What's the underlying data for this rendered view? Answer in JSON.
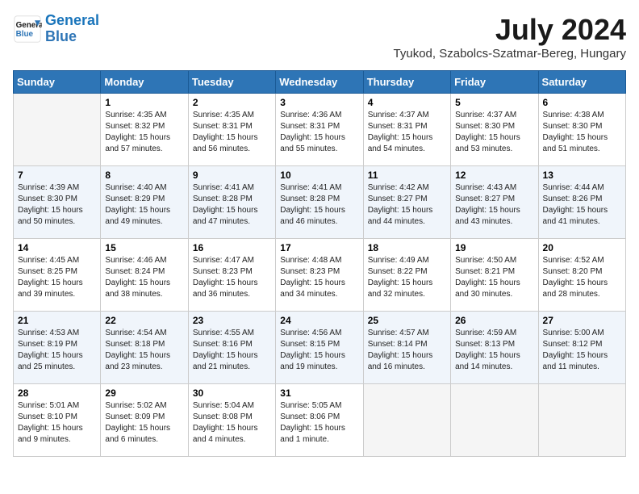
{
  "header": {
    "logo_line1": "General",
    "logo_line2": "Blue",
    "main_title": "July 2024",
    "subtitle": "Tyukod, Szabolcs-Szatmar-Bereg, Hungary"
  },
  "columns": [
    "Sunday",
    "Monday",
    "Tuesday",
    "Wednesday",
    "Thursday",
    "Friday",
    "Saturday"
  ],
  "weeks": [
    [
      {
        "day": "",
        "info": ""
      },
      {
        "day": "1",
        "info": "Sunrise: 4:35 AM\nSunset: 8:32 PM\nDaylight: 15 hours\nand 57 minutes."
      },
      {
        "day": "2",
        "info": "Sunrise: 4:35 AM\nSunset: 8:31 PM\nDaylight: 15 hours\nand 56 minutes."
      },
      {
        "day": "3",
        "info": "Sunrise: 4:36 AM\nSunset: 8:31 PM\nDaylight: 15 hours\nand 55 minutes."
      },
      {
        "day": "4",
        "info": "Sunrise: 4:37 AM\nSunset: 8:31 PM\nDaylight: 15 hours\nand 54 minutes."
      },
      {
        "day": "5",
        "info": "Sunrise: 4:37 AM\nSunset: 8:30 PM\nDaylight: 15 hours\nand 53 minutes."
      },
      {
        "day": "6",
        "info": "Sunrise: 4:38 AM\nSunset: 8:30 PM\nDaylight: 15 hours\nand 51 minutes."
      }
    ],
    [
      {
        "day": "7",
        "info": "Sunrise: 4:39 AM\nSunset: 8:30 PM\nDaylight: 15 hours\nand 50 minutes."
      },
      {
        "day": "8",
        "info": "Sunrise: 4:40 AM\nSunset: 8:29 PM\nDaylight: 15 hours\nand 49 minutes."
      },
      {
        "day": "9",
        "info": "Sunrise: 4:41 AM\nSunset: 8:28 PM\nDaylight: 15 hours\nand 47 minutes."
      },
      {
        "day": "10",
        "info": "Sunrise: 4:41 AM\nSunset: 8:28 PM\nDaylight: 15 hours\nand 46 minutes."
      },
      {
        "day": "11",
        "info": "Sunrise: 4:42 AM\nSunset: 8:27 PM\nDaylight: 15 hours\nand 44 minutes."
      },
      {
        "day": "12",
        "info": "Sunrise: 4:43 AM\nSunset: 8:27 PM\nDaylight: 15 hours\nand 43 minutes."
      },
      {
        "day": "13",
        "info": "Sunrise: 4:44 AM\nSunset: 8:26 PM\nDaylight: 15 hours\nand 41 minutes."
      }
    ],
    [
      {
        "day": "14",
        "info": "Sunrise: 4:45 AM\nSunset: 8:25 PM\nDaylight: 15 hours\nand 39 minutes."
      },
      {
        "day": "15",
        "info": "Sunrise: 4:46 AM\nSunset: 8:24 PM\nDaylight: 15 hours\nand 38 minutes."
      },
      {
        "day": "16",
        "info": "Sunrise: 4:47 AM\nSunset: 8:23 PM\nDaylight: 15 hours\nand 36 minutes."
      },
      {
        "day": "17",
        "info": "Sunrise: 4:48 AM\nSunset: 8:23 PM\nDaylight: 15 hours\nand 34 minutes."
      },
      {
        "day": "18",
        "info": "Sunrise: 4:49 AM\nSunset: 8:22 PM\nDaylight: 15 hours\nand 32 minutes."
      },
      {
        "day": "19",
        "info": "Sunrise: 4:50 AM\nSunset: 8:21 PM\nDaylight: 15 hours\nand 30 minutes."
      },
      {
        "day": "20",
        "info": "Sunrise: 4:52 AM\nSunset: 8:20 PM\nDaylight: 15 hours\nand 28 minutes."
      }
    ],
    [
      {
        "day": "21",
        "info": "Sunrise: 4:53 AM\nSunset: 8:19 PM\nDaylight: 15 hours\nand 25 minutes."
      },
      {
        "day": "22",
        "info": "Sunrise: 4:54 AM\nSunset: 8:18 PM\nDaylight: 15 hours\nand 23 minutes."
      },
      {
        "day": "23",
        "info": "Sunrise: 4:55 AM\nSunset: 8:16 PM\nDaylight: 15 hours\nand 21 minutes."
      },
      {
        "day": "24",
        "info": "Sunrise: 4:56 AM\nSunset: 8:15 PM\nDaylight: 15 hours\nand 19 minutes."
      },
      {
        "day": "25",
        "info": "Sunrise: 4:57 AM\nSunset: 8:14 PM\nDaylight: 15 hours\nand 16 minutes."
      },
      {
        "day": "26",
        "info": "Sunrise: 4:59 AM\nSunset: 8:13 PM\nDaylight: 15 hours\nand 14 minutes."
      },
      {
        "day": "27",
        "info": "Sunrise: 5:00 AM\nSunset: 8:12 PM\nDaylight: 15 hours\nand 11 minutes."
      }
    ],
    [
      {
        "day": "28",
        "info": "Sunrise: 5:01 AM\nSunset: 8:10 PM\nDaylight: 15 hours\nand 9 minutes."
      },
      {
        "day": "29",
        "info": "Sunrise: 5:02 AM\nSunset: 8:09 PM\nDaylight: 15 hours\nand 6 minutes."
      },
      {
        "day": "30",
        "info": "Sunrise: 5:04 AM\nSunset: 8:08 PM\nDaylight: 15 hours\nand 4 minutes."
      },
      {
        "day": "31",
        "info": "Sunrise: 5:05 AM\nSunset: 8:06 PM\nDaylight: 15 hours\nand 1 minute."
      },
      {
        "day": "",
        "info": ""
      },
      {
        "day": "",
        "info": ""
      },
      {
        "day": "",
        "info": ""
      }
    ]
  ]
}
